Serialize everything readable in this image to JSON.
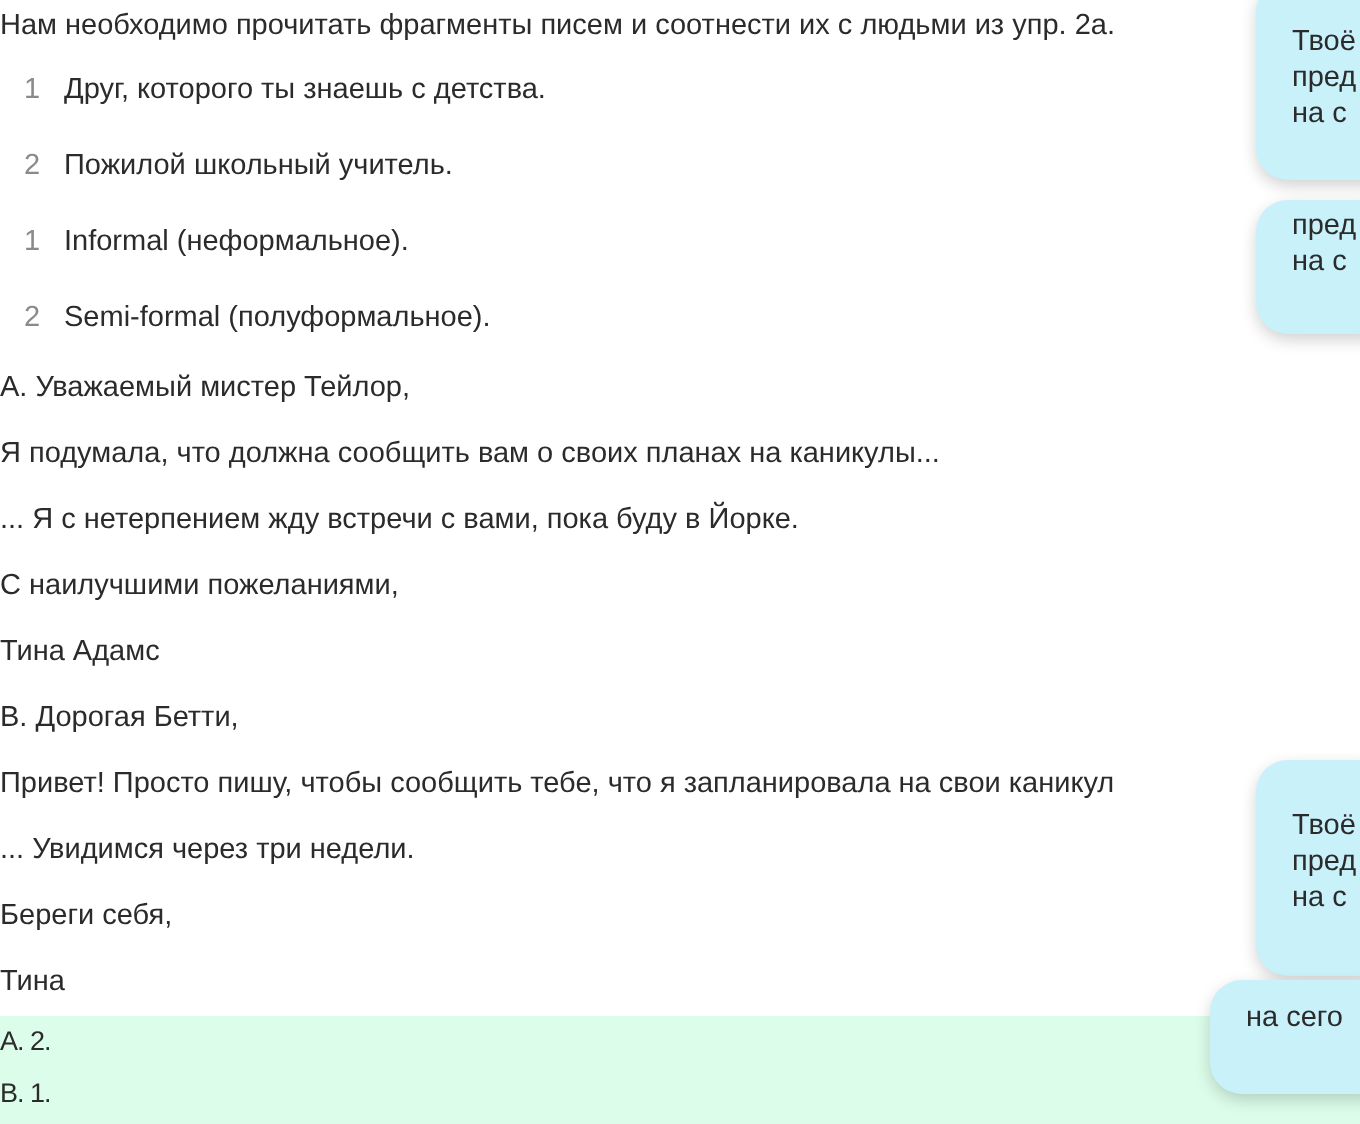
{
  "intro": "Нам необходимо прочитать фрагменты писем и соотнести их с людьми из упр. 2а.",
  "lists": [
    {
      "items": [
        {
          "number": "1",
          "text": "Друг, которого ты знаешь с детства."
        },
        {
          "number": "2",
          "text": "Пожилой школьный учитель."
        }
      ]
    },
    {
      "items": [
        {
          "number": "1",
          "text": "Informal (неформальное)."
        },
        {
          "number": "2",
          "text": "Semi-formal (полуформальное)."
        }
      ]
    }
  ],
  "letter_lines": [
    "А. Уважаемый мистер Тейлор,",
    "Я подумала, что должна сообщить вам о своих планах на каникулы...",
    "... Я с нетерпением жду встречи с вами, пока буду в Йорке.",
    "С наилучшими пожеланиями,",
    "Тина Адамс",
    "В. Дорогая Бетти,",
    "Привет! Просто пишу, чтобы сообщить тебе, что я запланировала на свои каникул",
    "... Увидимся через три недели.",
    "Береги себя,",
    "Тина"
  ],
  "answers": [
    "А. 2.",
    "В. 1."
  ],
  "popups": [
    {
      "lines": [
        "Твоё",
        "пред",
        "на с"
      ]
    },
    {
      "lines": [
        "пред",
        "на с"
      ]
    },
    {
      "lines": [
        "Твоё",
        "пред",
        "на с"
      ]
    },
    {
      "lines": [
        "на сего"
      ]
    }
  ]
}
